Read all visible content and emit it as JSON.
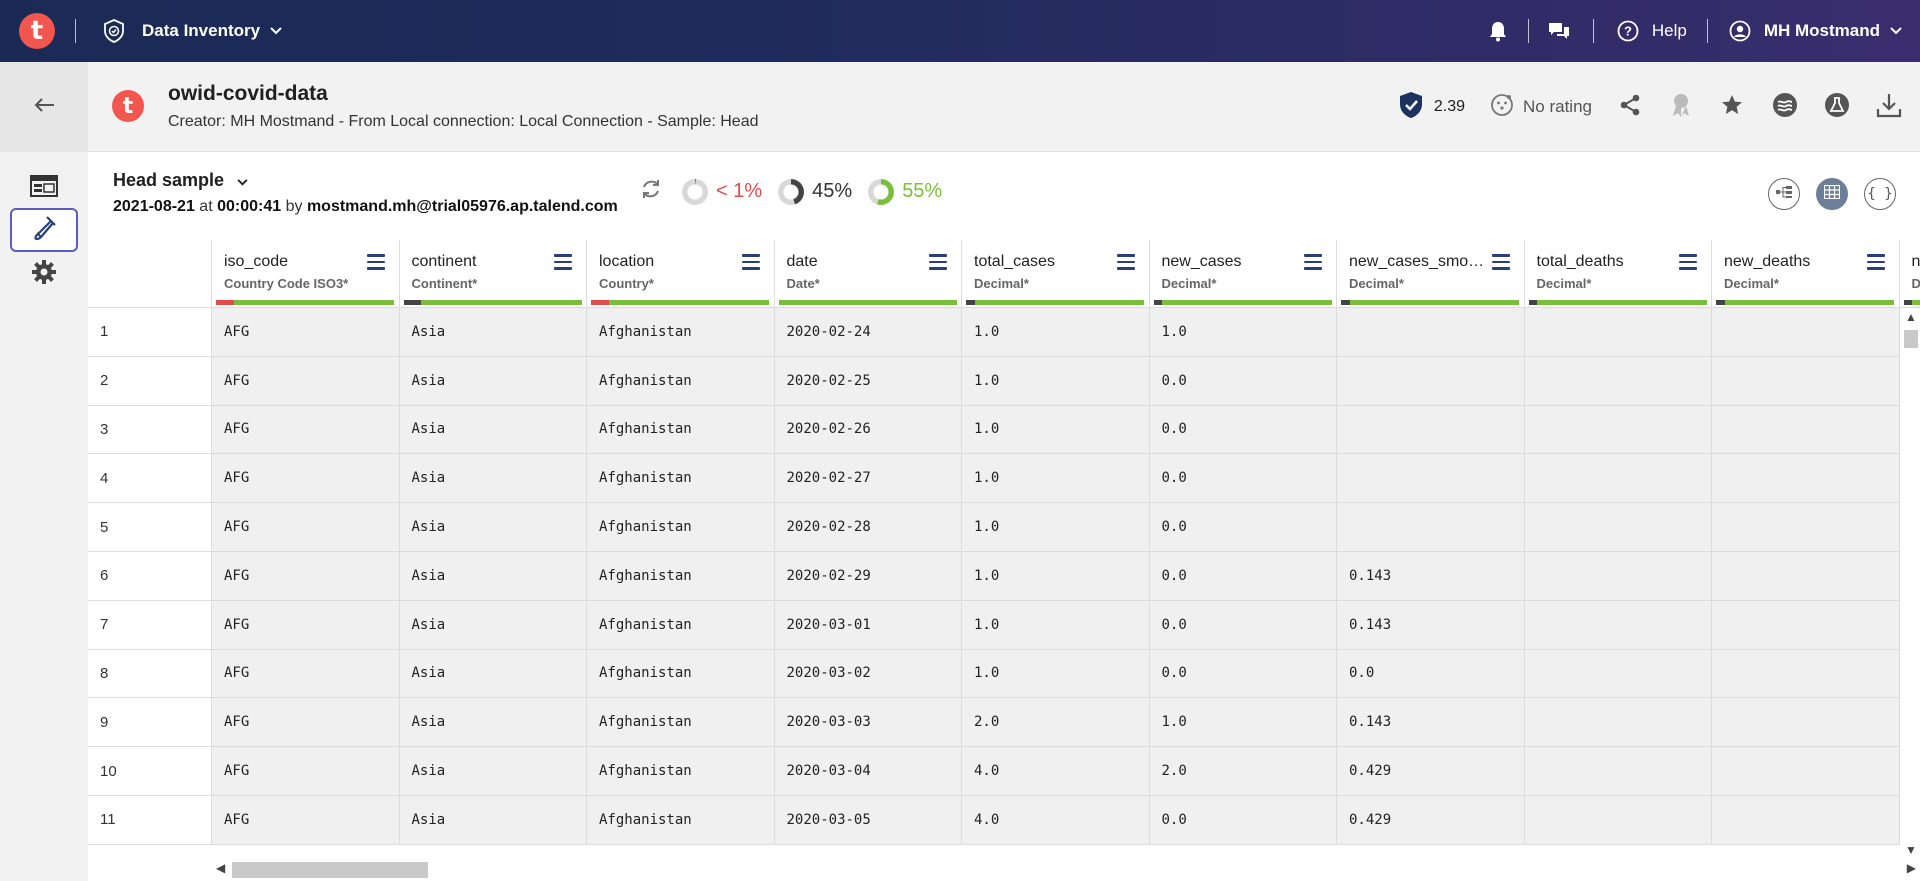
{
  "topbar": {
    "app_name": "Data Inventory",
    "help_label": "Help",
    "user_name": "MH Mostmand",
    "logo_letter": "t"
  },
  "dataset": {
    "logo_letter": "t",
    "title": "owid-covid-data",
    "subtitle": "Creator: MH Mostmand - From Local connection: Local Connection - Sample: Head",
    "trust_score": "2.39",
    "rating": "No rating"
  },
  "sample": {
    "title": "Head sample",
    "date": "2021-08-21",
    "at_word": "at",
    "time": "00:00:41",
    "by_word": "by",
    "user": "mostmand.mh@trial05976.ap.talend.com",
    "invalid_label": "< 1%",
    "empty_label": "45%",
    "valid_label": "55%"
  },
  "quality_fractions": {
    "invalid": 0.01,
    "empty": 0.45,
    "valid": 0.55
  },
  "colors": {
    "accent": "#2a3f78",
    "invalid": "#e14b4b",
    "valid": "#7abf3c",
    "empty": "#444444"
  },
  "columns": [
    {
      "name": "iso_code",
      "type": "Country Code ISO3*",
      "invalid": 0.1,
      "empty": 0.0
    },
    {
      "name": "continent",
      "type": "Continent*",
      "invalid": 0.0,
      "empty": 0.1
    },
    {
      "name": "location",
      "type": "Country*",
      "invalid": 0.1,
      "empty": 0.0
    },
    {
      "name": "date",
      "type": "Date*",
      "invalid": 0.0,
      "empty": 0.0
    },
    {
      "name": "total_cases",
      "type": "Decimal*",
      "invalid": 0.0,
      "empty": 0.05
    },
    {
      "name": "new_cases",
      "type": "Decimal*",
      "invalid": 0.0,
      "empty": 0.05
    },
    {
      "name": "new_cases_smoothed",
      "type": "Decimal*",
      "invalid": 0.0,
      "empty": 0.05
    },
    {
      "name": "total_deaths",
      "type": "Decimal*",
      "invalid": 0.0,
      "empty": 0.05
    },
    {
      "name": "new_deaths",
      "type": "Decimal*",
      "invalid": 0.0,
      "empty": 0.05
    },
    {
      "name": "n",
      "type": "D",
      "invalid": 0.0,
      "empty": 0.05
    }
  ],
  "rows": [
    {
      "index": "1",
      "cells": [
        "AFG",
        "Asia",
        "Afghanistan",
        "2020-02-24",
        "1.0",
        "1.0",
        "",
        "",
        "",
        ""
      ]
    },
    {
      "index": "2",
      "cells": [
        "AFG",
        "Asia",
        "Afghanistan",
        "2020-02-25",
        "1.0",
        "0.0",
        "",
        "",
        "",
        ""
      ]
    },
    {
      "index": "3",
      "cells": [
        "AFG",
        "Asia",
        "Afghanistan",
        "2020-02-26",
        "1.0",
        "0.0",
        "",
        "",
        "",
        ""
      ]
    },
    {
      "index": "4",
      "cells": [
        "AFG",
        "Asia",
        "Afghanistan",
        "2020-02-27",
        "1.0",
        "0.0",
        "",
        "",
        "",
        ""
      ]
    },
    {
      "index": "5",
      "cells": [
        "AFG",
        "Asia",
        "Afghanistan",
        "2020-02-28",
        "1.0",
        "0.0",
        "",
        "",
        "",
        ""
      ]
    },
    {
      "index": "6",
      "cells": [
        "AFG",
        "Asia",
        "Afghanistan",
        "2020-02-29",
        "1.0",
        "0.0",
        "0.143",
        "",
        "",
        ""
      ]
    },
    {
      "index": "7",
      "cells": [
        "AFG",
        "Asia",
        "Afghanistan",
        "2020-03-01",
        "1.0",
        "0.0",
        "0.143",
        "",
        "",
        ""
      ]
    },
    {
      "index": "8",
      "cells": [
        "AFG",
        "Asia",
        "Afghanistan",
        "2020-03-02",
        "1.0",
        "0.0",
        "0.0",
        "",
        "",
        ""
      ]
    },
    {
      "index": "9",
      "cells": [
        "AFG",
        "Asia",
        "Afghanistan",
        "2020-03-03",
        "2.0",
        "1.0",
        "0.143",
        "",
        "",
        ""
      ]
    },
    {
      "index": "10",
      "cells": [
        "AFG",
        "Asia",
        "Afghanistan",
        "2020-03-04",
        "4.0",
        "2.0",
        "0.429",
        "",
        "",
        ""
      ]
    },
    {
      "index": "11",
      "cells": [
        "AFG",
        "Asia",
        "Afghanistan",
        "2020-03-05",
        "4.0",
        "0.0",
        "0.429",
        "",
        "",
        ""
      ]
    }
  ],
  "icons": {
    "app": "shield-check-icon",
    "bell": "bell-icon",
    "chat": "chat-icon",
    "help": "help-circle-icon",
    "user": "user-circle-icon",
    "back": "arrow-left-icon",
    "preview": "table-preview-icon",
    "preparation": "flask-icon",
    "settings": "gear-icon",
    "refresh": "refresh-icon",
    "share": "share-icon",
    "certify": "badge-icon",
    "favorite": "star-icon",
    "semantic": "semantic-icon",
    "lab": "lab-icon",
    "download": "download-icon"
  }
}
